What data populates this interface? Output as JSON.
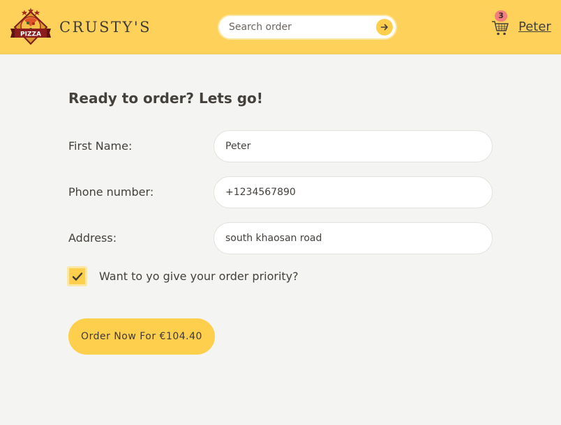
{
  "header": {
    "brand": "CRUSTY'S",
    "logo_text": "PIZZA",
    "search_placeholder": "Search order",
    "cart_count": "3",
    "user_name": "Peter"
  },
  "form": {
    "title": "Ready to order? Lets go!",
    "first_name_label": "First Name:",
    "first_name_value": "Peter",
    "phone_label": "Phone number:",
    "phone_value": "+1234567890",
    "address_label": "Address:",
    "address_value": "south khaosan road",
    "priority_label": "Want to yo give your order priority?",
    "priority_checked": true,
    "submit_label": "Order Now For €104.40"
  },
  "colors": {
    "header_bg": "#fed25a",
    "accent": "#fecf4d",
    "page_bg": "#f4f4f2",
    "badge": "#f47e7e"
  }
}
